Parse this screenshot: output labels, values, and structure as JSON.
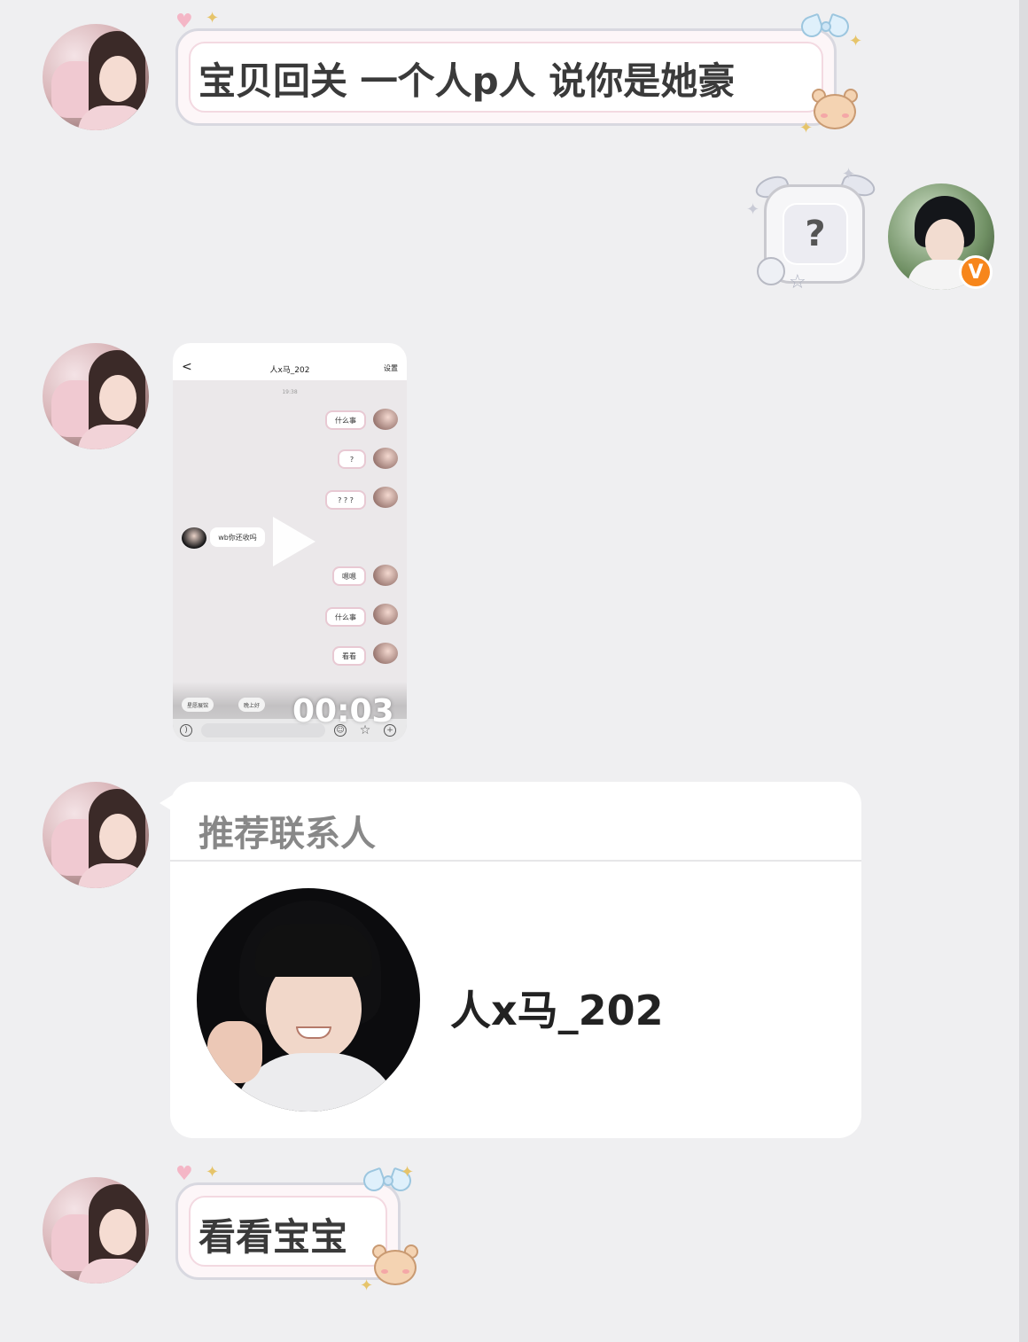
{
  "messages": [
    {
      "from": "her",
      "type": "text",
      "text": "宝贝回关 一个人p人 说你是她豪"
    },
    {
      "from": "me",
      "type": "text",
      "text": "?"
    },
    {
      "from": "her",
      "type": "video",
      "duration": "00:03",
      "preview": {
        "header_title": "人x马_202",
        "header_settings": "设置",
        "back_glyph": "<",
        "time": "19:38",
        "bubbles": [
          "什么事",
          "?",
          "? ? ?",
          "嗯嗯",
          "什么事",
          "看看"
        ],
        "incoming": "wb你还收吗",
        "quick_chips": [
          "星愿展馆",
          "晚上好"
        ]
      }
    },
    {
      "from": "her",
      "type": "contact_card",
      "title": "推荐联系人",
      "contact_name": "人x马_202"
    },
    {
      "from": "her",
      "type": "text",
      "text": "看看宝宝"
    }
  ],
  "me_badge": "V",
  "colors": {
    "background": "#efeff1",
    "badge": "#f7861b",
    "card": "#ffffff"
  }
}
